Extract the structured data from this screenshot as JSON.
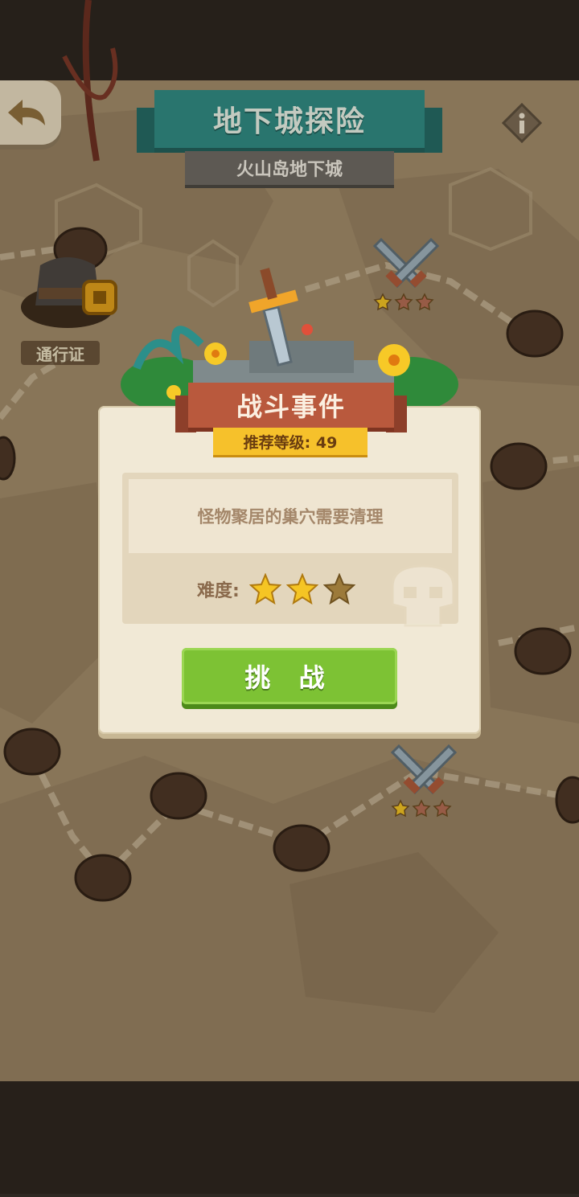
{
  "header": {
    "title": "地下城探险",
    "subtitle": "火山岛地下城"
  },
  "map": {
    "pass_label": "通行证",
    "battle_nodes": [
      {
        "stars_earned": 1,
        "stars_total": 3
      },
      {
        "stars_earned": 1,
        "stars_total": 3
      }
    ]
  },
  "event_panel": {
    "title": "战斗事件",
    "recommended_level": "推荐等级: 49",
    "description": "怪物聚居的巢穴需要清理",
    "difficulty_label": "难度:",
    "difficulty_stars_filled": 2,
    "difficulty_stars_total": 3,
    "challenge_label": "挑 战"
  },
  "icons": {
    "back": "back-arrow-icon",
    "info": "info-icon",
    "battle": "crossed-swords-icon",
    "cave": "cave-node-icon"
  },
  "colors": {
    "title_banner": "#2e8c86",
    "panel_header": "#b9593d",
    "level_pill": "#f6c12b",
    "challenge_button": "#7dc234",
    "star_filled": "#f5c524",
    "star_empty": "#9c7a3a"
  }
}
